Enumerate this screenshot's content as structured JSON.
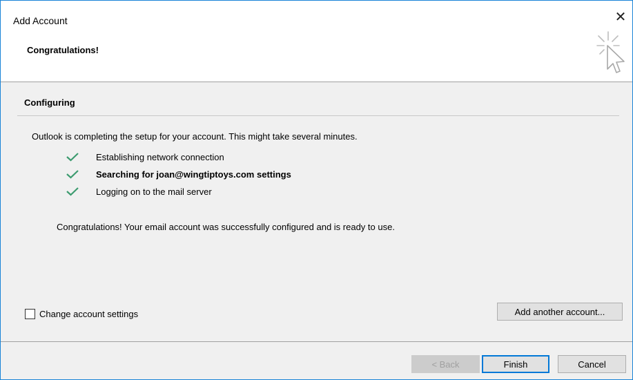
{
  "window": {
    "title": "Add Account",
    "close_glyph": "✕",
    "subtitle": "Congratulations!",
    "header_icon": "cursor-click-icon",
    "border_color": "#1883d7"
  },
  "section": {
    "title": "Configuring",
    "intro": "Outlook is completing the setup for your account. This might take several minutes.",
    "steps": [
      {
        "label": "Establishing network connection",
        "status": "done",
        "icon": "check-icon",
        "bold": false
      },
      {
        "label": "Searching for joan@wingtiptoys.com settings",
        "status": "done",
        "icon": "check-icon",
        "bold": true
      },
      {
        "label": "Logging on to the mail server",
        "status": "done",
        "icon": "check-icon",
        "bold": false
      }
    ],
    "result": "Congratulations! Your email account was successfully configured and is ready to use.",
    "check_color": "#3c9b6f"
  },
  "options": {
    "change_settings_label": "Change account settings",
    "change_settings_checked": false,
    "add_another_label": "Add another account..."
  },
  "footer": {
    "back_label": "< Back",
    "back_enabled": false,
    "finish_label": "Finish",
    "cancel_label": "Cancel",
    "accent_color": "#0078d7"
  }
}
